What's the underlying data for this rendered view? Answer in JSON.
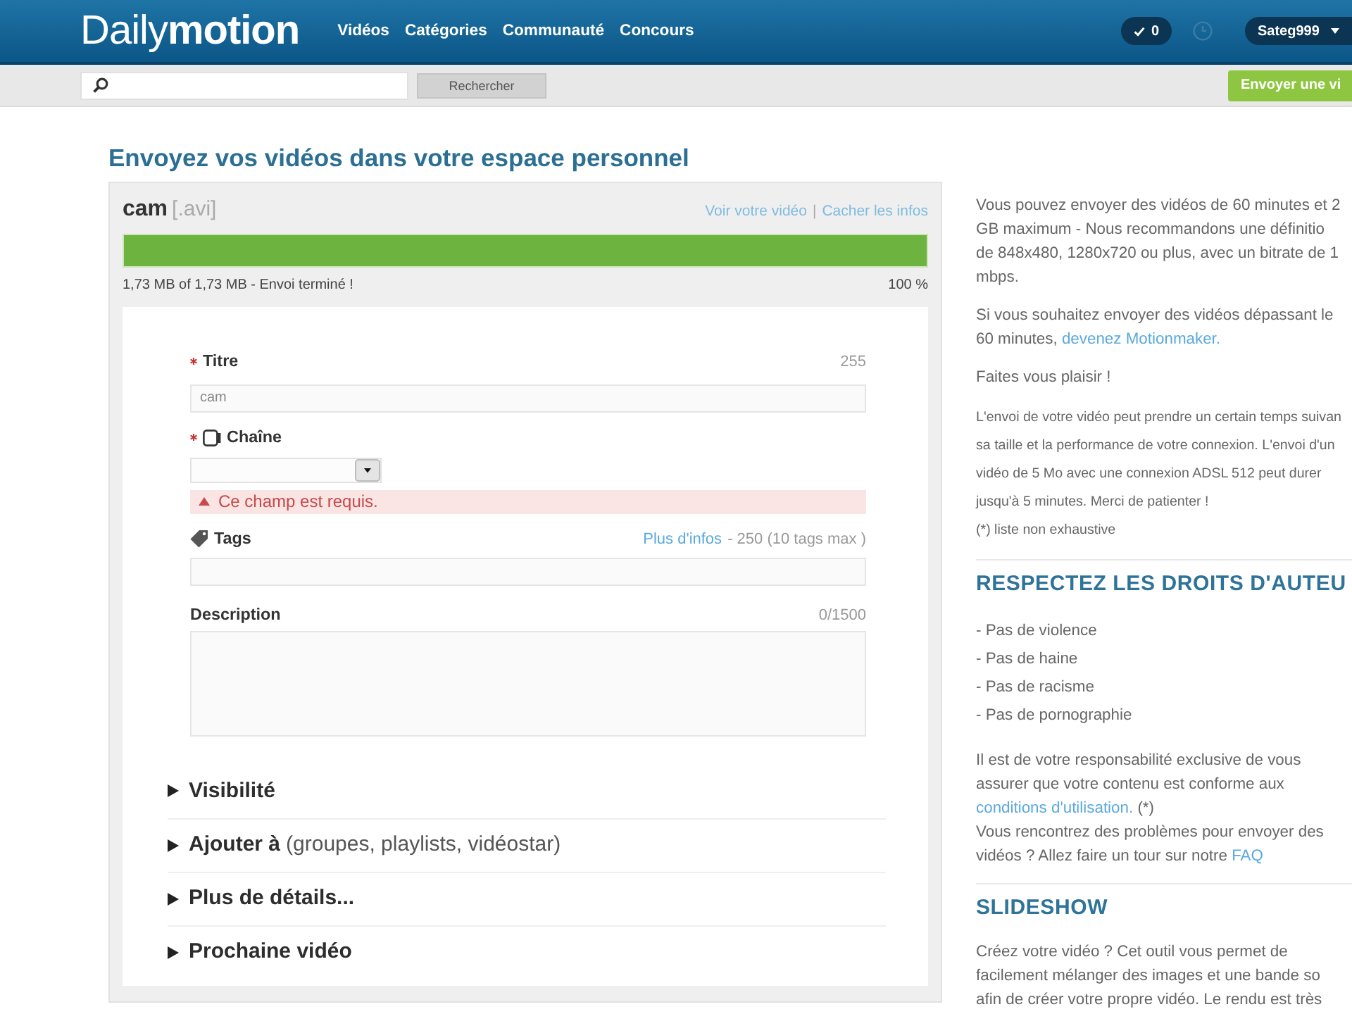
{
  "header": {
    "logo": {
      "regular": "Daily",
      "bold": "motion"
    },
    "nav": [
      {
        "label": "Vidéos"
      },
      {
        "label": "Catégories"
      },
      {
        "label": "Communauté"
      },
      {
        "label": "Concours"
      }
    ],
    "notifications": {
      "count": "0"
    },
    "user": {
      "name": "Sateg999"
    }
  },
  "search_bar": {
    "button": "Rechercher",
    "upload_button": "Envoyer une vi"
  },
  "page_title": "Envoyez vos vidéos dans votre espace personnel",
  "upload": {
    "file_name": "cam",
    "extension": "[.avi]",
    "links": [
      "Voir votre vidéo",
      "Cacher les infos"
    ],
    "separator": "|",
    "level": 1,
    "status": "1,73 MB of 1,73 MB - Envoi terminé !",
    "percent": "100 %",
    "fields": [
      {
        "kind": "text",
        "label": "Titre",
        "required": true,
        "counter": "255",
        "value": "cam"
      },
      {
        "kind": "select",
        "label": "Chaîne",
        "required": true,
        "error": "Ce champ est requis."
      },
      {
        "kind": "tags",
        "label": "Tags",
        "required": false,
        "link": "Plus d'infos",
        "counter": "- 250 (10 tags max )"
      },
      {
        "kind": "textarea",
        "label": "Description",
        "required": false,
        "counter": "0/1500"
      }
    ],
    "sections": [
      {
        "label": "Visibilité",
        "expanded": false
      },
      {
        "label": "Ajouter à",
        "note": "(groupes, playlists, vidéostar)",
        "expanded": false
      },
      {
        "label": "Plus de détails...",
        "expanded": false
      },
      {
        "label": "Prochaine vidéo",
        "expanded": false
      }
    ]
  },
  "sidebar": {
    "blocks": [
      {
        "paragraphs": [
          {
            "kind": "text",
            "parts": [
              {
                "kind": "text",
                "text": "Vous pouvez envoyer des vidéos de 60 minutes et 2\nGB maximum - Nous recommandons une définitio\nde 848x480, 1280x720 ou plus, avec un bitrate de 1\nmbps."
              }
            ]
          },
          {
            "kind": "text",
            "parts": [
              {
                "kind": "text",
                "text": "Si vous souhaitez envoyer des vidéos dépassant le\n60 minutes, "
              },
              {
                "kind": "link",
                "text": "devenez Motionmaker."
              }
            ]
          },
          {
            "kind": "text",
            "parts": [
              {
                "kind": "text",
                "text": "Faites vous plaisir !"
              }
            ]
          },
          {
            "kind": "fine_print",
            "parts": [
              {
                "kind": "text",
                "text": "L'envoi de votre vidéo peut prendre un certain temps suivan\nsa taille et la performance de votre connexion. L'envoi d'un\nvidéo de 5 Mo avec une connexion ADSL 512 peut durer\njusqu'à 5 minutes. Merci de patienter !"
              }
            ]
          },
          {
            "kind": "fine_print",
            "parts": [
              {
                "kind": "text",
                "text": "(*) liste non exhaustive"
              }
            ]
          }
        ]
      },
      {
        "title": "RESPECTEZ LES DROITS D'AUTEU",
        "items": [
          "- Pas de violence",
          "- Pas de haine",
          "- Pas de racisme",
          "- Pas de pornographie"
        ],
        "paragraphs": [
          {
            "kind": "text",
            "parts": [
              {
                "kind": "text",
                "text": "Il est de votre responsabilité exclusive de vous\nassurer que votre contenu est conforme aux\n"
              },
              {
                "kind": "link",
                "text": "conditions d'utilisation."
              },
              {
                "kind": "text",
                "text": " (*)\nVous rencontrez des problèmes pour envoyer des\nvidéos ? Allez faire un tour sur notre "
              },
              {
                "kind": "link",
                "text": "FAQ"
              }
            ]
          }
        ]
      },
      {
        "title": "SLIDESHOW",
        "paragraphs": [
          {
            "kind": "text",
            "parts": [
              {
                "kind": "text",
                "text": "Créez votre vidéo ? Cet outil vous permet de\nfacilement mélanger des images et une bande so\nafin de créer votre propre vidéo. Le rendu est très"
              }
            ]
          }
        ]
      }
    ]
  }
}
